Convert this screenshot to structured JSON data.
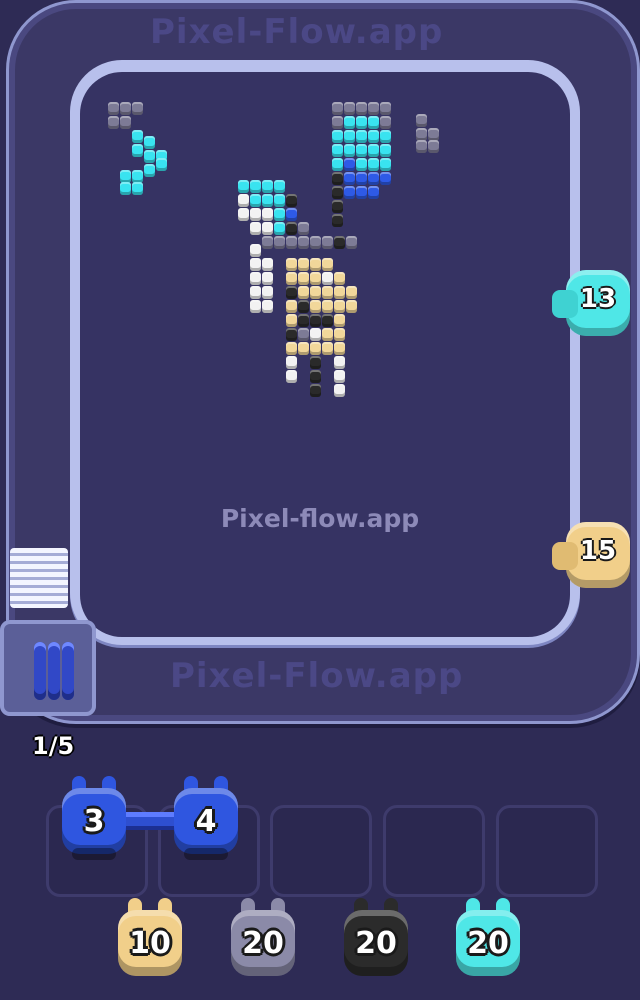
{
  "watermark": {
    "main": "Pixel-flow.app",
    "track": "Pixel-Flow.app"
  },
  "colors": {
    "background": "#2e2b55",
    "cyan": "#39e3f0",
    "blue": "#2e5ae6",
    "gray": "#7d7b96",
    "white": "#f2f2f2",
    "cream": "#f1d79a",
    "black": "#2a2a2a"
  },
  "queue": {
    "progress_label": "1/5"
  },
  "side_shooters": [
    {
      "name": "cyan-shooter",
      "count": "13",
      "color": "#4fe7e7"
    },
    {
      "name": "cream-shooter",
      "count": "15",
      "color": "#f1cf8a"
    }
  ],
  "active_shooters": [
    {
      "count": "3",
      "color": "#2f56e0"
    },
    {
      "count": "4",
      "color": "#2f56e0"
    }
  ],
  "waiting_shooters": [
    {
      "count": "10",
      "color": "#f1cf8a"
    },
    {
      "count": "20",
      "color": "#8b8aa8"
    },
    {
      "count": "20",
      "color": "#2b2b2b"
    },
    {
      "count": "20",
      "color": "#4fe7e7"
    }
  ],
  "empty_slots": 5
}
